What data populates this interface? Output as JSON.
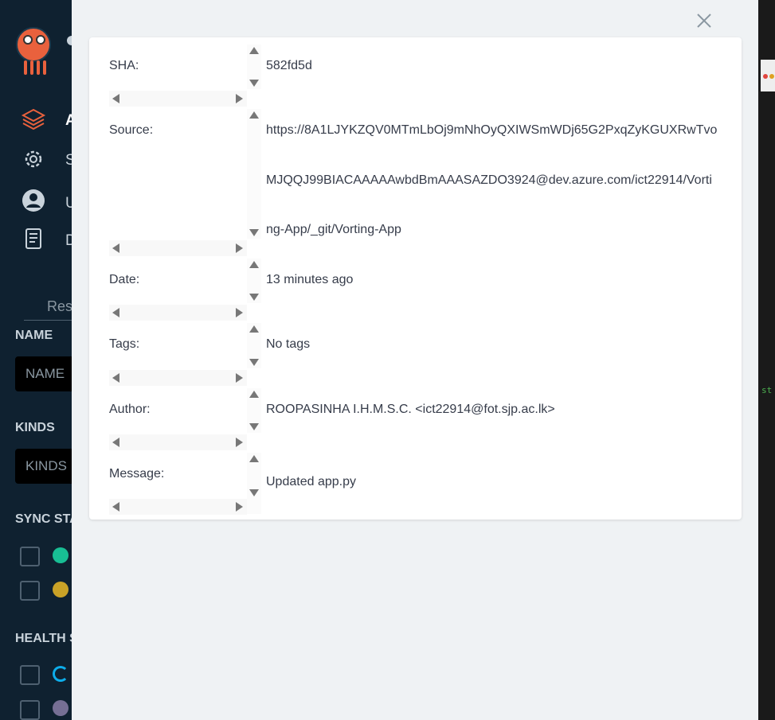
{
  "sidebar": {
    "nav_items": [
      {
        "icon": "layers-icon",
        "label": "A"
      },
      {
        "icon": "gear-icon",
        "label": "S"
      },
      {
        "icon": "user-icon",
        "label": "U"
      },
      {
        "icon": "docs-icon",
        "label": "D"
      }
    ],
    "resources_tab": "Res",
    "name_label": "NAME",
    "name_placeholder": "NAME",
    "kinds_label": "KINDS",
    "kinds_placeholder": "KINDS",
    "sync_status_label": "SYNC STA",
    "health_status_label": "HEALTH S",
    "sync_items": [
      {
        "icon": "synced-check-icon",
        "color": "#18be94"
      },
      {
        "icon": "out-of-sync-arrow-icon",
        "color": "#c9a227"
      }
    ],
    "health_items": [
      {
        "icon": "progressing-circle-icon",
        "color": "#0dadea"
      },
      {
        "icon": "suspended-pause-icon",
        "color": "#766f94"
      }
    ]
  },
  "terminal": {
    "text": "st"
  },
  "panel": {
    "close_icon": "close-icon",
    "rows": [
      {
        "label": "SHA:",
        "value": "582fd5d"
      },
      {
        "label": "Source:",
        "value_lines": [
          "https://8A1LJYKZQV0MTmLbOj9mNhOyQXIWSmWDj65G2PxqZyKGUXRwTvo",
          "MJQQJ99BIACAAAAAwbdBmAAASAZDO3924@dev.azure.com/ict22914/Vorti",
          "ng-App/_git/Vorting-App"
        ]
      },
      {
        "label": "Date:",
        "value": "13 minutes ago"
      },
      {
        "label": "Tags:",
        "value": "No tags"
      },
      {
        "label": "Author:",
        "value": "ROOPASINHA I.H.M.S.C. <ict22914@fot.sjp.ac.lk>"
      },
      {
        "label": "Message:",
        "value": "Updated app.py"
      }
    ]
  }
}
